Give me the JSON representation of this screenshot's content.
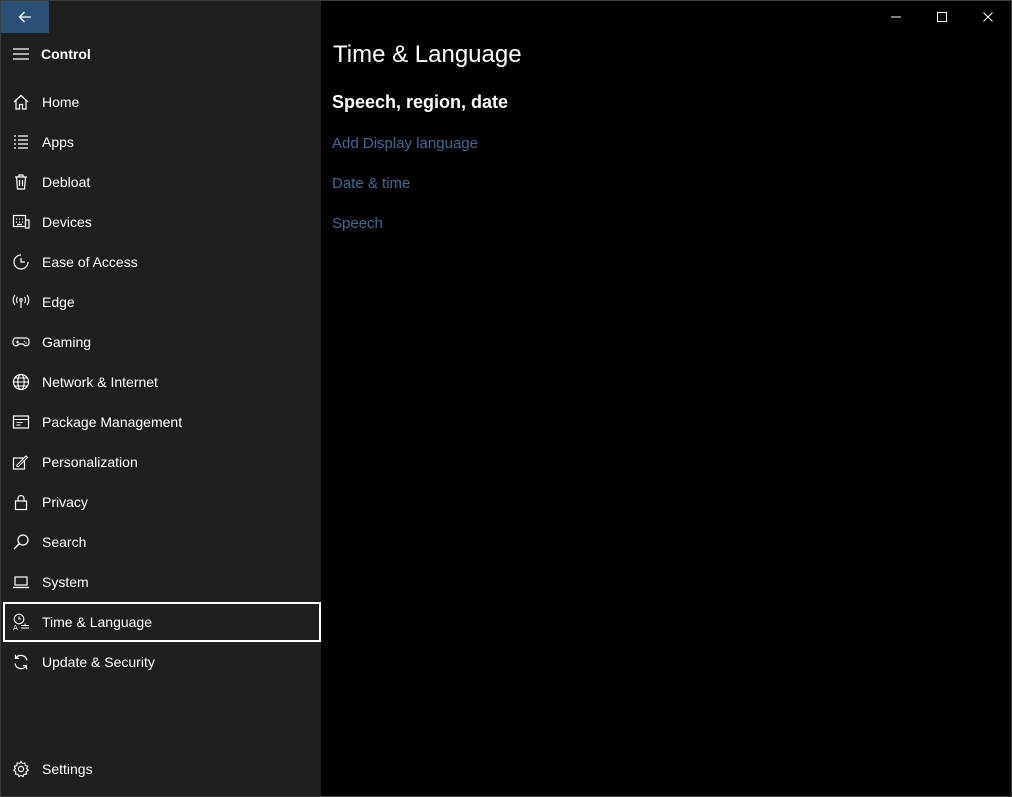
{
  "app": {
    "title": "Control"
  },
  "nav": {
    "items": [
      {
        "label": "Home",
        "icon": "home-icon"
      },
      {
        "label": "Apps",
        "icon": "apps-list-icon"
      },
      {
        "label": "Debloat",
        "icon": "trash-icon"
      },
      {
        "label": "Devices",
        "icon": "keyboard-icon"
      },
      {
        "label": "Ease of Access",
        "icon": "ease-of-access-icon"
      },
      {
        "label": "Edge",
        "icon": "broadcast-icon"
      },
      {
        "label": "Gaming",
        "icon": "gamepad-icon"
      },
      {
        "label": "Network & Internet",
        "icon": "globe-icon"
      },
      {
        "label": "Package Management",
        "icon": "package-icon"
      },
      {
        "label": "Personalization",
        "icon": "paint-icon"
      },
      {
        "label": "Privacy",
        "icon": "lock-icon"
      },
      {
        "label": "Search",
        "icon": "search-icon"
      },
      {
        "label": "System",
        "icon": "laptop-icon"
      },
      {
        "label": "Time & Language",
        "icon": "time-language-icon",
        "selected": true
      },
      {
        "label": "Update & Security",
        "icon": "sync-icon"
      }
    ],
    "settings_label": "Settings"
  },
  "content": {
    "title": "Time & Language",
    "section_title": "Speech, region, date",
    "links": [
      "Add Display language",
      "Date & time",
      "Speech"
    ]
  },
  "colors": {
    "accent": "#2b5078",
    "link": "#3e6a95",
    "sidebar": "#1f1f1f"
  }
}
